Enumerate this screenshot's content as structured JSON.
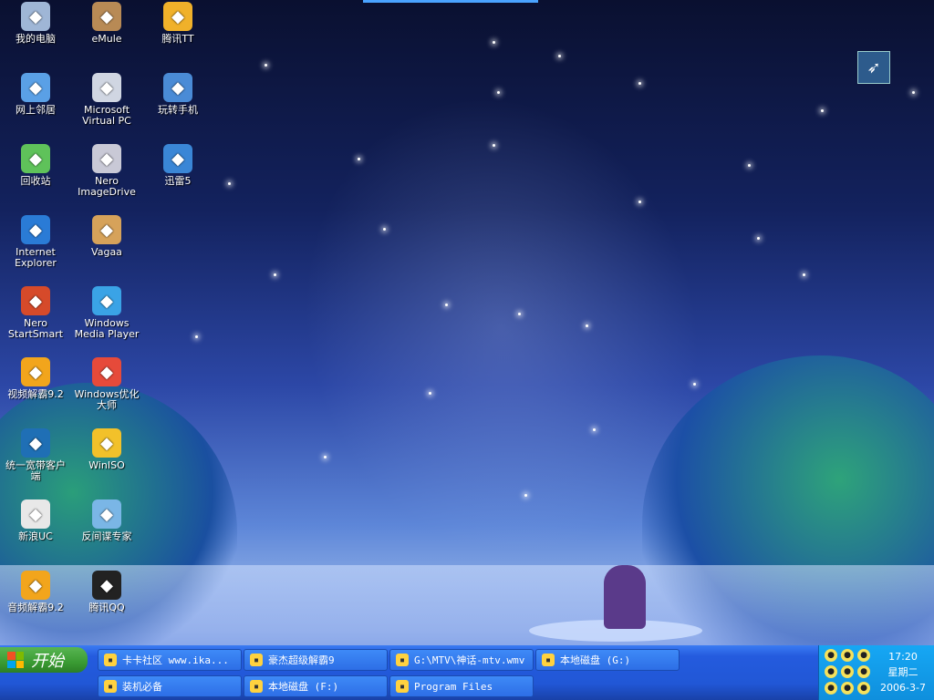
{
  "desktop": {
    "icons": [
      {
        "label": "我的电脑",
        "icon": "computer-icon",
        "color": "#9fb6d6"
      },
      {
        "label": "eMule",
        "icon": "mule-icon",
        "color": "#b88a55"
      },
      {
        "label": "腾讯TT",
        "icon": "browser-tt-icon",
        "color": "#f0b12a"
      },
      {
        "label": "网上邻居",
        "icon": "network-icon",
        "color": "#5aa0e6"
      },
      {
        "label": "Microsoft\nVirtual PC",
        "icon": "virtual-pc-icon",
        "color": "#d0d6e2"
      },
      {
        "label": "玩转手机",
        "icon": "phone-icon",
        "color": "#4a8bd6"
      },
      {
        "label": "回收站",
        "icon": "recycle-bin-icon",
        "color": "#5fc25a"
      },
      {
        "label": "Nero\nImageDrive",
        "icon": "disc-icon",
        "color": "#c9c9d6"
      },
      {
        "label": "迅雷5",
        "icon": "thunder-icon",
        "color": "#3a86d6"
      },
      {
        "label": "Internet\nExplorer",
        "icon": "ie-icon",
        "color": "#2a7bd6"
      },
      {
        "label": "Vagaa",
        "icon": "vagaa-icon",
        "color": "#d6a25a"
      },
      {
        "label": "Nero\nStartSmart",
        "icon": "nero-icon",
        "color": "#d64a2a"
      },
      {
        "label": "Windows\nMedia Player",
        "icon": "media-player-icon",
        "color": "#3aa3e6"
      },
      {
        "label": "视频解霸9.2",
        "icon": "video-player-icon",
        "color": "#f2a51c"
      },
      {
        "label": "Windows优化\n大师",
        "icon": "optimizer-icon",
        "color": "#e64a3a"
      },
      {
        "label": "统一宽带客户\n端",
        "icon": "broadband-icon",
        "color": "#1f6fb5"
      },
      {
        "label": "WinISO",
        "icon": "winiso-icon",
        "color": "#f2c12a"
      },
      {
        "label": "新浪UC",
        "icon": "uc-icon",
        "color": "#e8e8e8"
      },
      {
        "label": "反间谍专家",
        "icon": "antispy-icon",
        "color": "#7ab6e6"
      },
      {
        "label": "音频解霸9.2",
        "icon": "audio-player-icon",
        "color": "#f2a51c"
      },
      {
        "label": "腾讯QQ",
        "icon": "qq-icon",
        "color": "#222222"
      }
    ]
  },
  "taskbar": {
    "start_label": "开始",
    "buttons": [
      {
        "label": "卡卡社区 www.ika...",
        "icon": "browser-icon"
      },
      {
        "label": "豪杰超级解霸9",
        "icon": "video-player-icon"
      },
      {
        "label": "G:\\MTV\\神话-mtv.wmv",
        "icon": "thunder-icon"
      },
      {
        "label": "本地磁盘 (G:)",
        "icon": "drive-icon"
      },
      {
        "label": "装机必备",
        "icon": "folder-icon"
      },
      {
        "label": "本地磁盘 (F:)",
        "icon": "drive-icon"
      },
      {
        "label": "Program Files",
        "icon": "folder-icon"
      }
    ]
  },
  "tray": {
    "time": "17:20",
    "weekday": "星期二",
    "date": "2006-3-7"
  }
}
